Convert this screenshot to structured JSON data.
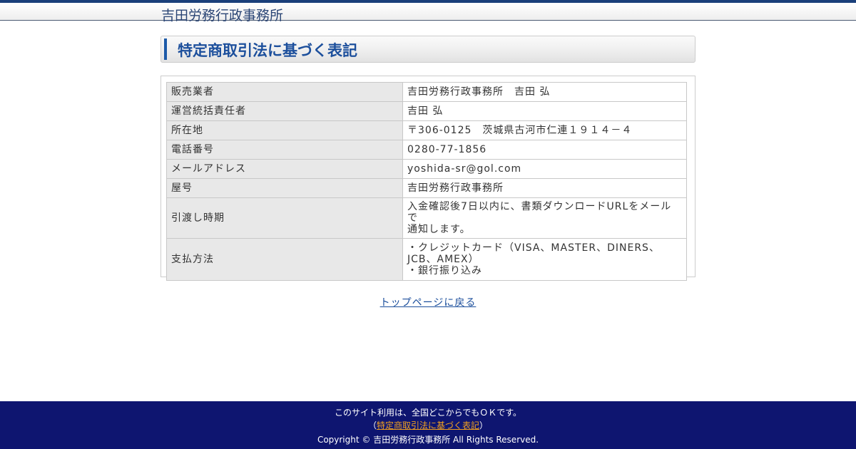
{
  "header": {
    "site_name": "吉田労務行政事務所"
  },
  "page": {
    "title": "特定商取引法に基づく表記"
  },
  "table": {
    "rows": [
      {
        "label": "販売業者",
        "value": "吉田労務行政事務所　吉田 弘"
      },
      {
        "label": "運営統括責任者",
        "value": "吉田 弘"
      },
      {
        "label": "所在地",
        "value": "〒306-0125　茨城県古河市仁連１９１４－４"
      },
      {
        "label": "電話番号",
        "value": "0280-77-1856"
      },
      {
        "label": "メールアドレス",
        "value": "yoshida-sr@gol.com"
      },
      {
        "label": "屋号",
        "value": "吉田労務行政事務所"
      },
      {
        "label": "引渡し時期",
        "value_lines": [
          "入金確認後7日以内に、書類ダウンロードURLをメールで",
          "通知します。"
        ]
      },
      {
        "label": "支払方法",
        "value_lines": [
          "・クレジットカード（VISA、MASTER、DINERS、",
          "JCB、AMEX）",
          "・銀行振り込み"
        ]
      }
    ]
  },
  "back_link": {
    "label": "トップページに戻る"
  },
  "footer": {
    "line1": "このサイト利用は、全国どこからでもＯＫです。",
    "paren_open": "（",
    "link_label": "特定商取引法に基づく表記",
    "paren_close": "）",
    "copyright": "Copyright © 吉田労務行政事務所 All Rights Reserved."
  }
}
